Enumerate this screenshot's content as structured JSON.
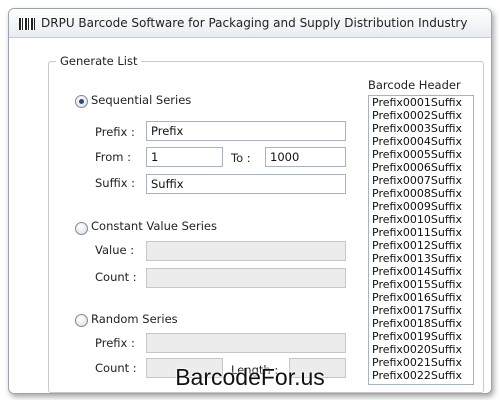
{
  "window": {
    "title": "DRPU Barcode Software for Packaging and Supply Distribution Industry"
  },
  "generate_list": {
    "group_label": "Generate List",
    "sequential": {
      "label": "Sequential Series",
      "selected": true,
      "prefix_label": "Prefix :",
      "prefix_value": "Prefix",
      "from_label": "From :",
      "from_value": "1",
      "to_label": "To :",
      "to_value": "1000",
      "suffix_label": "Suffix :",
      "suffix_value": "Suffix"
    },
    "constant": {
      "label": "Constant Value Series",
      "selected": false,
      "value_label": "Value :",
      "value_value": "",
      "count_label": "Count :",
      "count_value": ""
    },
    "random": {
      "label": "Random Series",
      "selected": false,
      "prefix_label": "Prefix :",
      "prefix_value": "",
      "count_label": "Count :",
      "count_value": "",
      "length_label": "Length :",
      "length_value": ""
    }
  },
  "barcode_header": {
    "label": "Barcode Header",
    "items": [
      "Prefix0001Suffix",
      "Prefix0002Suffix",
      "Prefix0003Suffix",
      "Prefix0004Suffix",
      "Prefix0005Suffix",
      "Prefix0006Suffix",
      "Prefix0007Suffix",
      "Prefix0008Suffix",
      "Prefix0009Suffix",
      "Prefix0010Suffix",
      "Prefix0011Suffix",
      "Prefix0012Suffix",
      "Prefix0013Suffix",
      "Prefix0014Suffix",
      "Prefix0015Suffix",
      "Prefix0016Suffix",
      "Prefix0017Suffix",
      "Prefix0018Suffix",
      "Prefix0019Suffix",
      "Prefix0020Suffix",
      "Prefix0021Suffix",
      "Prefix0022Suffix"
    ]
  },
  "watermark": "BarcodeFor.us",
  "icons": {
    "app": "barcode-icon"
  }
}
